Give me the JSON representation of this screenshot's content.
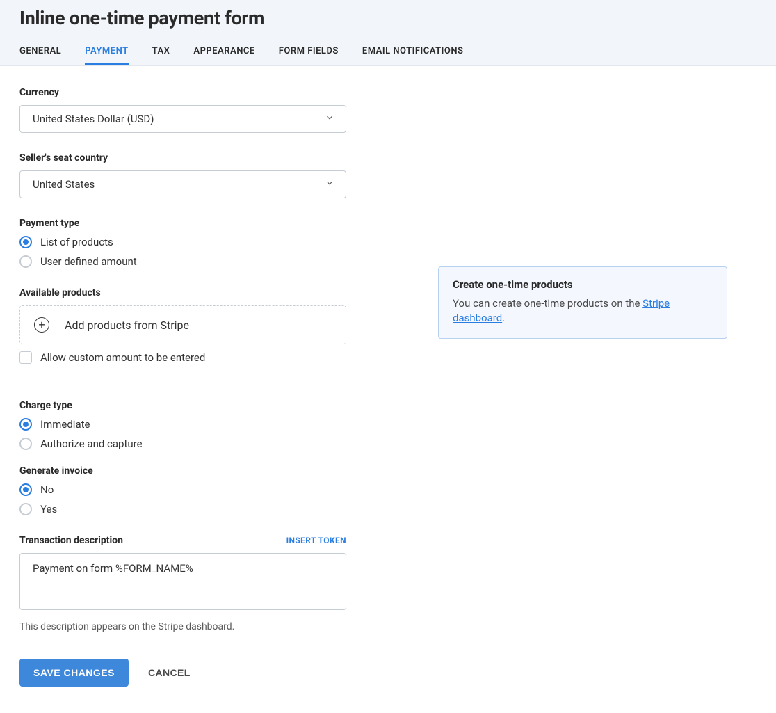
{
  "page_title": "Inline one-time payment form",
  "tabs": [
    {
      "label": "GENERAL",
      "active": false
    },
    {
      "label": "PAYMENT",
      "active": true
    },
    {
      "label": "TAX",
      "active": false
    },
    {
      "label": "APPEARANCE",
      "active": false
    },
    {
      "label": "FORM FIELDS",
      "active": false
    },
    {
      "label": "EMAIL NOTIFICATIONS",
      "active": false
    }
  ],
  "currency": {
    "label": "Currency",
    "value": "United States Dollar (USD)"
  },
  "seller_country": {
    "label": "Seller's seat country",
    "value": "United States"
  },
  "payment_type": {
    "label": "Payment type",
    "options": [
      {
        "label": "List of products",
        "checked": true
      },
      {
        "label": "User defined amount",
        "checked": false
      }
    ]
  },
  "available_products": {
    "label": "Available products",
    "add_label": "Add products from Stripe",
    "allow_custom_label": "Allow custom amount to be entered",
    "allow_custom_checked": false
  },
  "info_box": {
    "title": "Create one-time products",
    "text_prefix": "You can create one-time products on the ",
    "link_text": "Stripe dashboard",
    "text_suffix": "."
  },
  "charge_type": {
    "label": "Charge type",
    "options": [
      {
        "label": "Immediate",
        "checked": true
      },
      {
        "label": "Authorize and capture",
        "checked": false
      }
    ]
  },
  "generate_invoice": {
    "label": "Generate invoice",
    "options": [
      {
        "label": "No",
        "checked": true
      },
      {
        "label": "Yes",
        "checked": false
      }
    ]
  },
  "transaction_description": {
    "label": "Transaction description",
    "token_link": "INSERT TOKEN",
    "value": "Payment on form %FORM_NAME%",
    "help": "This description appears on the Stripe dashboard."
  },
  "buttons": {
    "save": "SAVE CHANGES",
    "cancel": "CANCEL"
  }
}
